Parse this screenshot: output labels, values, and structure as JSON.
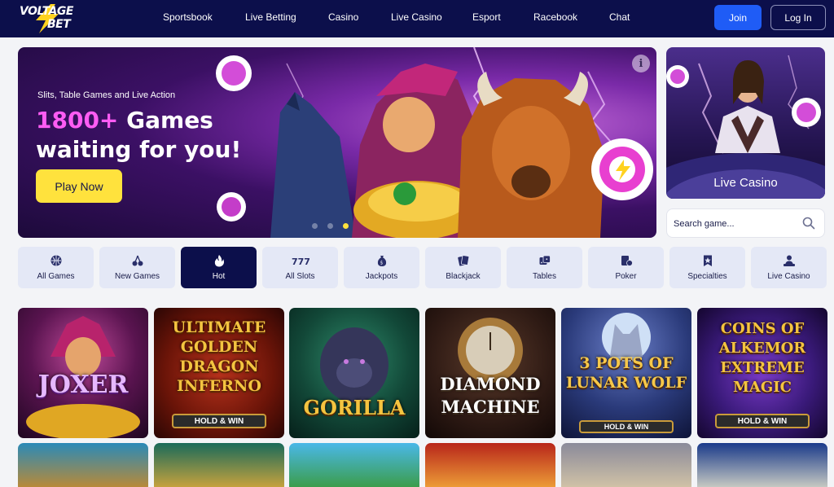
{
  "brand": {
    "line1": "VOLTAGE",
    "line2": "BET"
  },
  "nav": [
    "Sportsbook",
    "Live Betting",
    "Casino",
    "Live Casino",
    "Esport",
    "Racebook",
    "Chat"
  ],
  "auth": {
    "join": "Join",
    "login": "Log In"
  },
  "hero": {
    "subtitle": "Slits, Table Games and Live Action",
    "highlight": "1800+",
    "title_rest": " Games",
    "title_line2": "waiting for you!",
    "cta": "Play Now",
    "info": "i",
    "slide_count": 3,
    "active_slide": 3
  },
  "live_casino": {
    "label": "Live Casino"
  },
  "search": {
    "placeholder": "Search game..."
  },
  "categories": [
    {
      "label": "All Games",
      "icon": "globe-icon",
      "active": false
    },
    {
      "label": "New Games",
      "icon": "cherries-icon",
      "active": false
    },
    {
      "label": "Hot",
      "icon": "flame-icon",
      "active": true
    },
    {
      "label": "All Slots",
      "icon": "slots-777-icon",
      "active": false
    },
    {
      "label": "Jackpots",
      "icon": "money-bag-icon",
      "active": false
    },
    {
      "label": "Blackjack",
      "icon": "playing-cards-icon",
      "active": false
    },
    {
      "label": "Tables",
      "icon": "dice-icon",
      "active": false
    },
    {
      "label": "Poker",
      "icon": "poker-cards-icon",
      "active": false
    },
    {
      "label": "Specialties",
      "icon": "star-badge-icon",
      "active": false
    },
    {
      "label": "Live Casino",
      "icon": "dealer-icon",
      "active": false
    }
  ],
  "games": [
    {
      "title": "JOXER",
      "badge": ""
    },
    {
      "title": "ULTIMATE GOLDEN DRAGON INFERNO",
      "badge": "HOLD & WIN"
    },
    {
      "title": "GORILLA",
      "badge": ""
    },
    {
      "title": "DIAMOND MACHINE",
      "badge": ""
    },
    {
      "title": "3 POTS OF LUNAR WOLF",
      "badge": "HOLD & WIN"
    },
    {
      "title": "COINS OF ALKEMOR EXTREME MAGIC",
      "badge": "HOLD & WIN"
    }
  ],
  "colors": {
    "navy": "#0c0f4b",
    "join_blue": "#1f5cf6",
    "cta_yellow": "#ffe23d",
    "hero_pink": "#ff5cf4",
    "tab_bg": "#e4e8f6"
  }
}
